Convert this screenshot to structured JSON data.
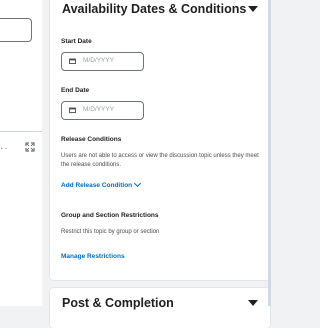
{
  "availability_panel": {
    "title": "Availability Dates & Conditions",
    "start_date": {
      "label": "Start Date",
      "placeholder": "M/D/YYYY"
    },
    "end_date": {
      "label": "End Date",
      "placeholder": "M/D/YYYY"
    },
    "release_conditions": {
      "heading": "Release Conditions",
      "description": "Users are not able to access or view the discussion topic unless they meet the release conditions.",
      "add_label": "Add Release Condition"
    },
    "group_restrictions": {
      "heading": "Group and Section Restrictions",
      "description": "Restrict this topic by group or section",
      "manage_label": "Manage Restrictions"
    }
  },
  "post_panel": {
    "title": "Post & Completion"
  },
  "icons": {
    "calendar": "calendar-icon",
    "expand": "expand-icon",
    "chevron": "chevron-down-icon"
  }
}
